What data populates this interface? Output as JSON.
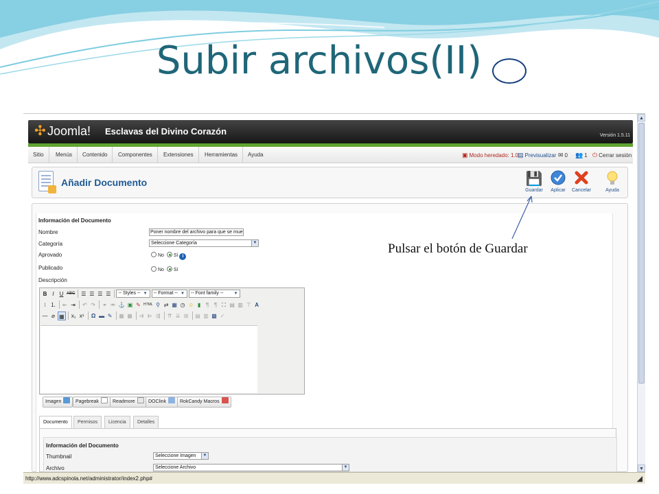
{
  "slide": {
    "title": "Subir archivos(II)"
  },
  "annotation": {
    "text": "Pulsar el botón de Guardar"
  },
  "colors": {
    "title": "#1f6678",
    "joomla_green": "#5fa333",
    "link_blue": "#1f5a94",
    "circle": "#17407f"
  },
  "browser": {
    "status_url": "http://www.adcspinola.net/administrator/index2.php#",
    "scroll_up_icon": "triangle-up-icon",
    "scroll_down_icon": "triangle-down-icon"
  },
  "header": {
    "logo_text": "Joomla!",
    "site_name": "Esclavas del Divino Corazón",
    "version": "Versión 1.5.11"
  },
  "menu": {
    "items": [
      "Sitio",
      "Menús",
      "Contenido",
      "Componentes",
      "Extensiones",
      "Herramientas",
      "Ayuda"
    ],
    "legacy_mode": "Modo heredado: 1.0",
    "preview": "Previsualizar",
    "messages_count": "0",
    "users_count": "1",
    "logout": "Cerrar sesión"
  },
  "toolbar": {
    "title": "Añadir Documento",
    "buttons": {
      "save": "Guardar",
      "apply": "Aplicar",
      "cancel": "Cancelar",
      "help": "Ayuda"
    }
  },
  "form": {
    "section_title": "Información del Documento",
    "name_label": "Nombre",
    "name_value": "Poner nombre del archivo para que se muestre",
    "category_label": "Categoría",
    "category_value": "Seleccione Categoría",
    "approved_label": "Aprovado",
    "published_label": "Publicado",
    "no_label": "No",
    "yes_label": "Sí",
    "description_label": "Descripción"
  },
  "editor": {
    "styles": "-- Styles --",
    "format": "-- Format --",
    "font_family": "-- Font family --",
    "html_label": "HTML"
  },
  "editor_buttons": {
    "image": "Imagen",
    "pagebreak": "Pagebreak",
    "readmore": "Readmore",
    "doclink": "DOClink",
    "rokcandy": "RokCandy Macros"
  },
  "tabs": [
    "Documento",
    "Permisos",
    "Licencia",
    "Detalles"
  ],
  "details": {
    "section_title": "Información del Documento",
    "thumbnail_label": "Thumbnail",
    "thumbnail_value": "Seleccione Imagen",
    "file_label": "Archivo",
    "file_value": "Seleccione Archivo"
  }
}
